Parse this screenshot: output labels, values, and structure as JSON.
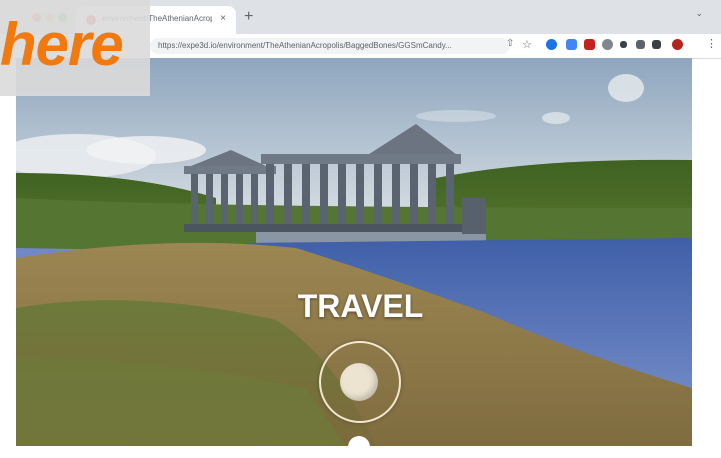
{
  "browser": {
    "tab_title": "environment/TheAthenianAcroplis",
    "tab_close": "×",
    "new_tab": "+",
    "url": "https://expe3d.io/environment/TheAthenianAcropolis/BaggedBones/GGSmCandy...",
    "menu": "⌄"
  },
  "overlay": {
    "label": "here"
  },
  "scene": {
    "action_label": "TRAVEL"
  },
  "colors": {
    "accent": "#f07a10",
    "sky": "#9ab0c6",
    "water": "#5a72b8",
    "grass": "#4c6a2a",
    "sand": "#a08a56"
  },
  "icons": {
    "share": "share-icon",
    "star": "star-icon",
    "menu": "kebab-icon",
    "joystick": "joystick-icon"
  }
}
